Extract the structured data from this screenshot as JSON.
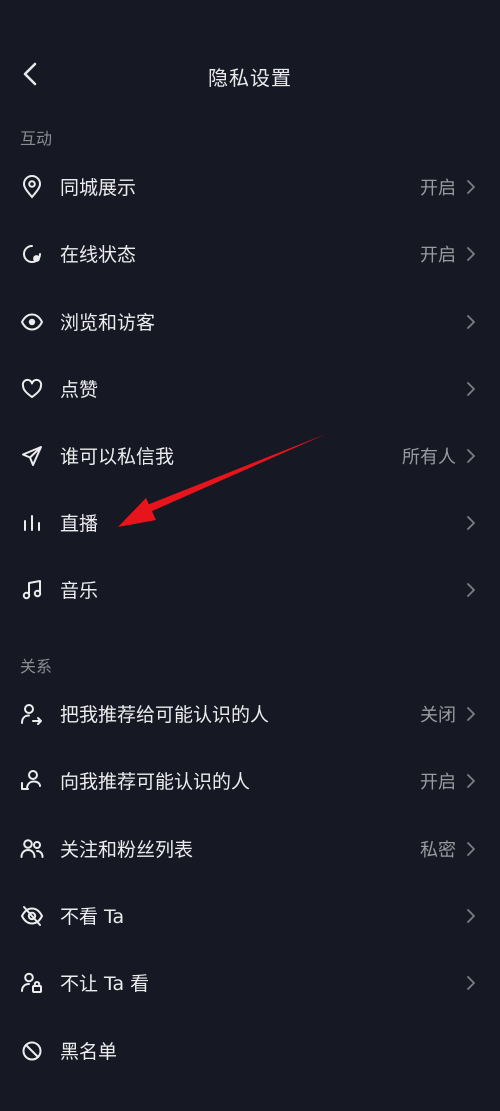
{
  "header": {
    "title": "隐私设置",
    "back_icon": "chevron-left-icon"
  },
  "sections": [
    {
      "label": "互动",
      "items": [
        {
          "label": "同城展示",
          "value": "开启",
          "icon": "location-pin-icon"
        },
        {
          "label": "在线状态",
          "value": "开启",
          "icon": "online-status-icon"
        },
        {
          "label": "浏览和访客",
          "value": "",
          "icon": "eye-icon"
        },
        {
          "label": "点赞",
          "value": "",
          "icon": "heart-icon"
        },
        {
          "label": "谁可以私信我",
          "value": "所有人",
          "icon": "send-icon"
        },
        {
          "label": "直播",
          "value": "",
          "icon": "live-bars-icon"
        },
        {
          "label": "音乐",
          "value": "",
          "icon": "music-note-icon"
        }
      ]
    },
    {
      "label": "关系",
      "items": [
        {
          "label": "把我推荐给可能认识的人",
          "value": "关闭",
          "icon": "user-share-icon"
        },
        {
          "label": "向我推荐可能认识的人",
          "value": "开启",
          "icon": "user-recommend-icon"
        },
        {
          "label": "关注和粉丝列表",
          "value": "私密",
          "icon": "users-icon"
        },
        {
          "label": "不看 Ta",
          "value": "",
          "icon": "eye-off-icon"
        },
        {
          "label": "不让 Ta 看",
          "value": "",
          "icon": "user-lock-icon"
        },
        {
          "label": "黑名单",
          "value": "",
          "icon": "block-icon"
        }
      ]
    }
  ],
  "colors": {
    "background": "#161823",
    "text": "#ececee",
    "secondary": "#9a9ba1",
    "annotation_arrow": "#e8141b"
  }
}
